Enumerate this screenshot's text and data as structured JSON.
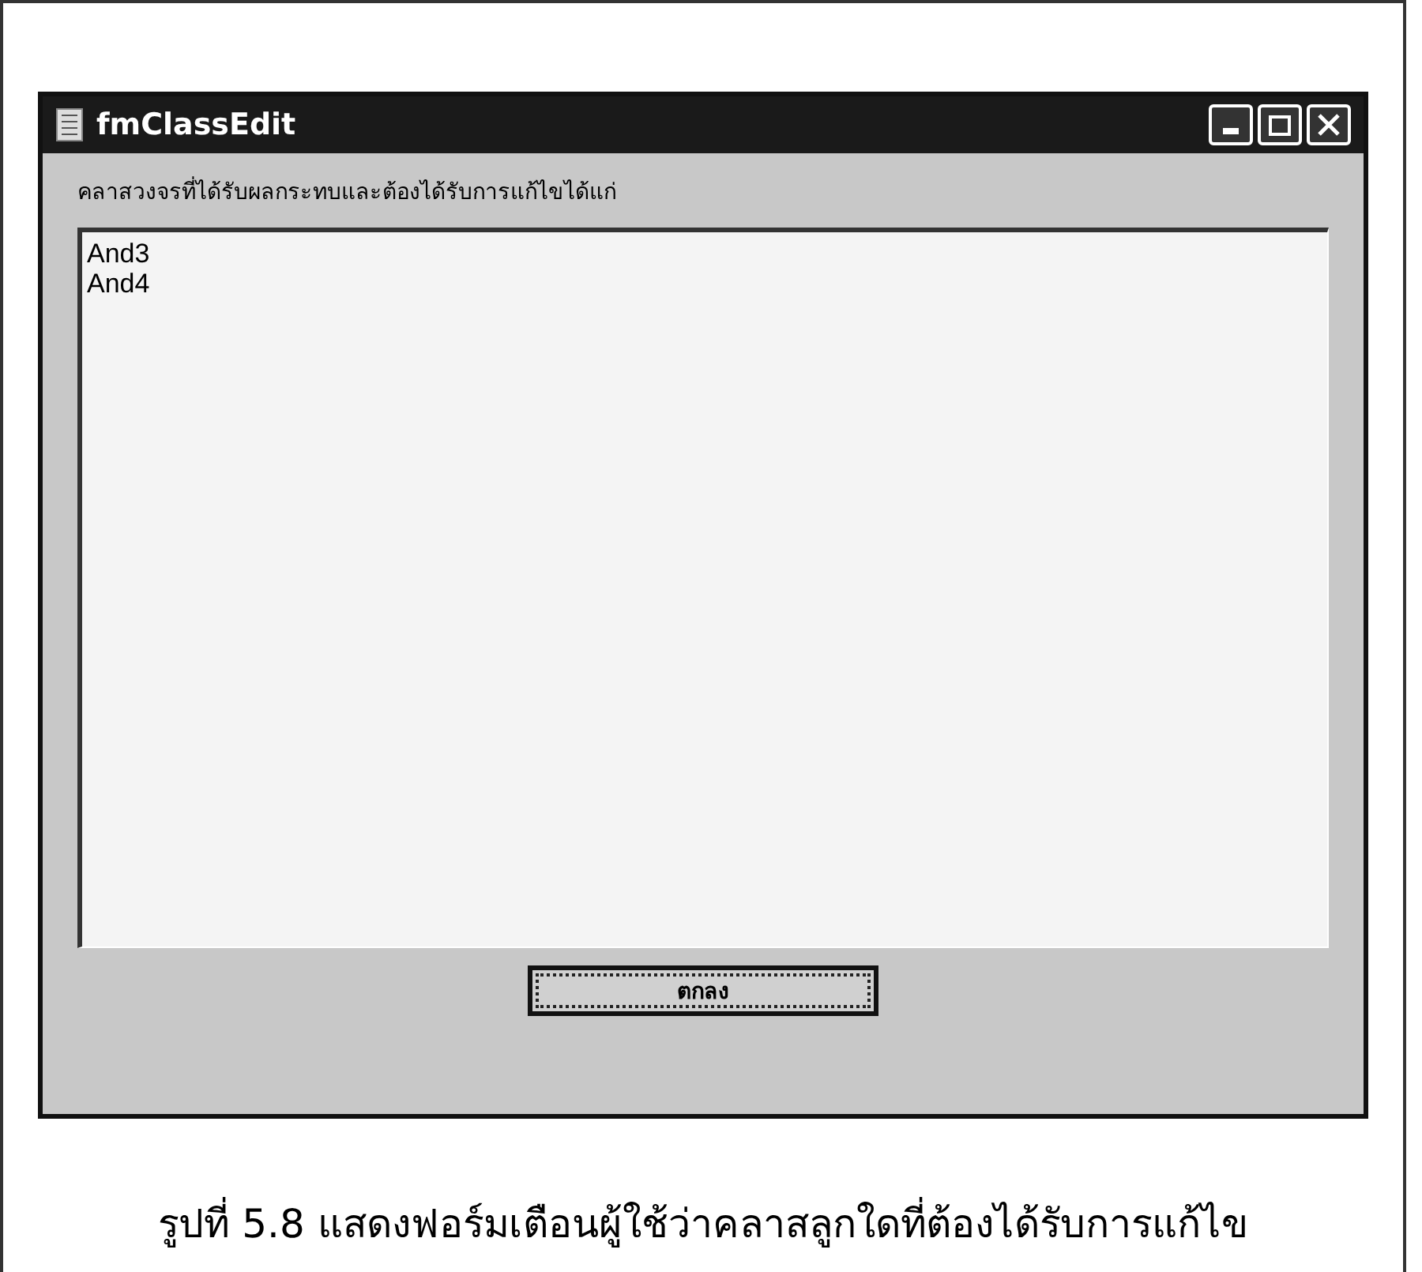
{
  "window": {
    "title": "fmClassEdit"
  },
  "label": "คลาสวงจรที่ได้รับผลกระทบและต้องได้รับการแก้ไขได้แก่",
  "list_items": [
    "And3",
    "And4"
  ],
  "button": {
    "label": "ตกลง",
    "focused": true
  },
  "caption": "รูปที่ 5.8 แสดงฟอร์มเตือนผู้ใช้ว่าคลาสลูกใดที่ต้องได้รับการแก้ไข"
}
